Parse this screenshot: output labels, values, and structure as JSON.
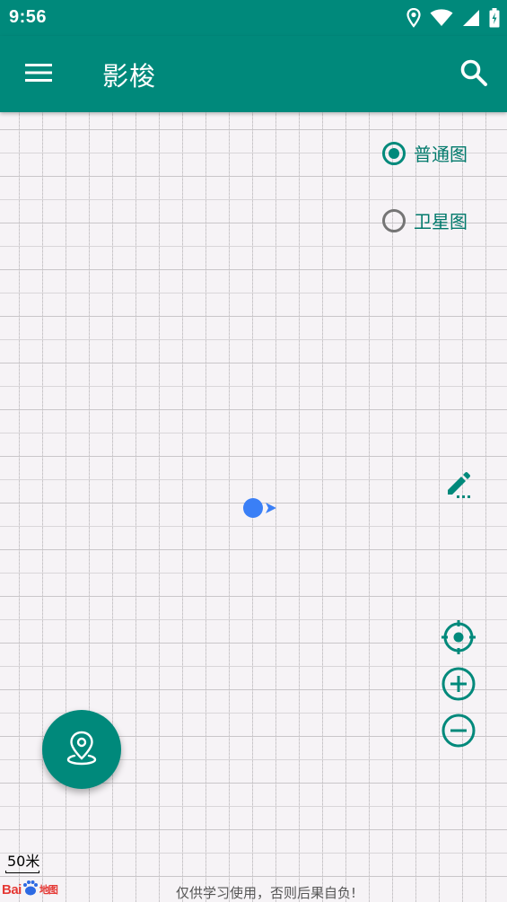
{
  "status_bar": {
    "time": "9:56",
    "icons": [
      "location-icon",
      "wifi-icon",
      "signal-icon",
      "battery-icon"
    ]
  },
  "app_bar": {
    "title": "影梭",
    "menu_icon": "hamburger-menu-icon",
    "search_icon": "search-icon"
  },
  "map": {
    "map_types": [
      {
        "label": "普通图",
        "checked": true
      },
      {
        "label": "卫星图",
        "checked": false
      }
    ],
    "scale_label": "50米",
    "logo_text": "Bai",
    "logo_sub": "地图",
    "disclaimer": "仅供学习使用，否则后果自负!",
    "controls": [
      "locate-icon",
      "zoom-in-icon",
      "zoom-out-icon"
    ],
    "edit_icon": "pencil-icon",
    "fab_icon": "map-pin-icon"
  },
  "colors": {
    "primary": "#00897b",
    "primary_dark_text": "#00796b",
    "marker": "#3a7ff6",
    "map_background": "#f6f3f6",
    "grid_line": "#c9c6c9",
    "baidu_red": "#e53935"
  }
}
